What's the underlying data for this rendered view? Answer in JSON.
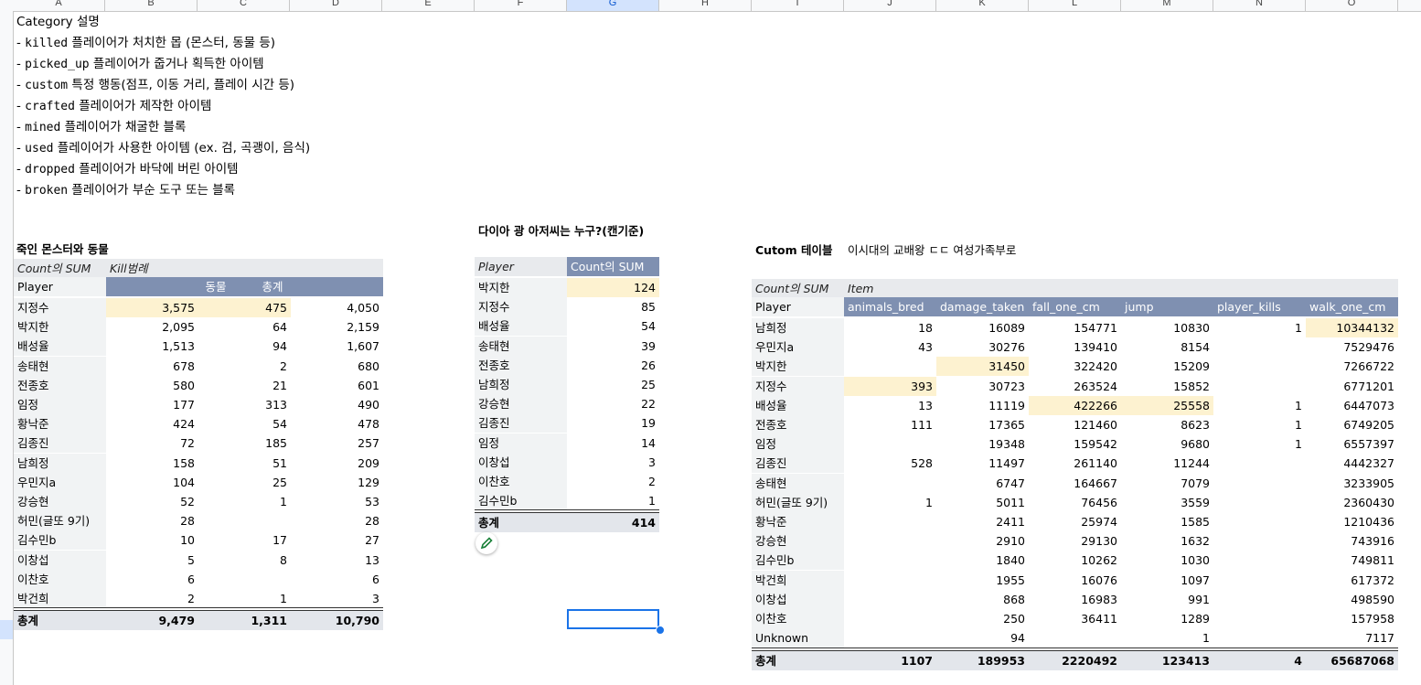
{
  "columns": [
    "A",
    "B",
    "C",
    "D",
    "E",
    "F",
    "G",
    "H",
    "I",
    "J",
    "K",
    "L",
    "M",
    "N",
    "O"
  ],
  "selected_column": "G",
  "notes": [
    {
      "text": "Category 설명",
      "code": ""
    },
    {
      "text": "- ",
      "code": "killed",
      "rest": " 플레이어가 처치한 몹 (몬스터, 동물 등)"
    },
    {
      "text": "- ",
      "code": "picked_up",
      "rest": " 플레이어가 줍거나 획득한 아이템"
    },
    {
      "text": "- ",
      "code": "custom",
      "rest": " 특정 행동(점프, 이동 거리, 플레이 시간 등)"
    },
    {
      "text": "- ",
      "code": "crafted",
      "rest": " 플레이어가 제작한 아이템"
    },
    {
      "text": "- ",
      "code": "mined",
      "rest": " 플레이어가 채굴한 블록"
    },
    {
      "text": "- ",
      "code": "used",
      "rest": " 플레이어가 사용한 아이템 (ex. 검, 곡괭이, 음식)"
    },
    {
      "text": "- ",
      "code": "dropped",
      "rest": " 플레이어가 바닥에 버린 아이템"
    },
    {
      "text": "- ",
      "code": "broken",
      "rest": " 플레이어가 부순 도구 또는 블록"
    }
  ],
  "kills": {
    "title": "죽인 몬스터와 동물",
    "meta_label": "Count의 SUM",
    "meta_value": "Kill범례",
    "header_player": "Player",
    "col1": "동물",
    "col2": "총계",
    "rows": [
      {
        "player": "지정수",
        "a": "3,575",
        "b": "475",
        "t": "4,050",
        "hl": [
          0,
          1
        ]
      },
      {
        "player": "박지한",
        "a": "2,095",
        "b": "64",
        "t": "2,159"
      },
      {
        "player": "배성율",
        "a": "1,513",
        "b": "94",
        "t": "1,607"
      },
      {
        "player": "송태현",
        "a": "678",
        "b": "2",
        "t": "680"
      },
      {
        "player": "전종호",
        "a": "580",
        "b": "21",
        "t": "601"
      },
      {
        "player": "임정",
        "a": "177",
        "b": "313",
        "t": "490"
      },
      {
        "player": "황낙준",
        "a": "424",
        "b": "54",
        "t": "478"
      },
      {
        "player": "김종진",
        "a": "72",
        "b": "185",
        "t": "257"
      },
      {
        "player": "남희정",
        "a": "158",
        "b": "51",
        "t": "209"
      },
      {
        "player": "우민지a",
        "a": "104",
        "b": "25",
        "t": "129"
      },
      {
        "player": "강승현",
        "a": "52",
        "b": "1",
        "t": "53"
      },
      {
        "player": "허민(글또 9기)",
        "a": "28",
        "b": "",
        "t": "28"
      },
      {
        "player": "김수민b",
        "a": "10",
        "b": "17",
        "t": "27"
      },
      {
        "player": "이창섭",
        "a": "5",
        "b": "8",
        "t": "13"
      },
      {
        "player": "이찬호",
        "a": "6",
        "b": "",
        "t": "6"
      },
      {
        "player": "박건희",
        "a": "2",
        "b": "1",
        "t": "3"
      }
    ],
    "total_label": "총계",
    "total": {
      "a": "9,479",
      "b": "1,311",
      "t": "10,790"
    }
  },
  "diamond": {
    "title": "다이아 광 아저씨는 누구?(캔기준)",
    "header_player": "Player",
    "header_value": "Count의 SUM",
    "rows": [
      {
        "player": "박지한",
        "v": "124",
        "hl": true
      },
      {
        "player": "지정수",
        "v": "85"
      },
      {
        "player": "배성율",
        "v": "54"
      },
      {
        "player": "송태현",
        "v": "39"
      },
      {
        "player": "전종호",
        "v": "26"
      },
      {
        "player": "남희정",
        "v": "25"
      },
      {
        "player": "강승현",
        "v": "22"
      },
      {
        "player": "김종진",
        "v": "19"
      },
      {
        "player": "임정",
        "v": "14"
      },
      {
        "player": "이창섭",
        "v": "3"
      },
      {
        "player": "이찬호",
        "v": "2"
      },
      {
        "player": "김수민b",
        "v": "1"
      }
    ],
    "total_label": "총계",
    "total": "414",
    "edit_icon": "pencil-icon"
  },
  "custom": {
    "title": "Cutom 테이블",
    "subtitle": "이시대의 교배왕 ㄷㄷ 여성가족부로",
    "meta_label": "Count의 SUM",
    "meta_value": "Item",
    "header_player": "Player",
    "headers": [
      "animals_bred",
      "damage_taken",
      "fall_one_cm",
      "jump",
      "player_kills",
      "walk_one_cm"
    ],
    "rows": [
      {
        "player": "남희정",
        "v": [
          "18",
          "16089",
          "154771",
          "10830",
          "1",
          "10344132"
        ],
        "hl": [
          5
        ]
      },
      {
        "player": "우민지a",
        "v": [
          "43",
          "30276",
          "139410",
          "8154",
          "",
          "7529476"
        ]
      },
      {
        "player": "박지한",
        "v": [
          "",
          "31450",
          "322420",
          "15209",
          "",
          "7266722"
        ],
        "hl": [
          1
        ]
      },
      {
        "player": "지정수",
        "v": [
          "393",
          "30723",
          "263524",
          "15852",
          "",
          "6771201"
        ],
        "hl": [
          0
        ]
      },
      {
        "player": "배성율",
        "v": [
          "13",
          "11119",
          "422266",
          "25558",
          "1",
          "6447073"
        ],
        "hl": [
          2,
          3
        ]
      },
      {
        "player": "전종호",
        "v": [
          "111",
          "17365",
          "121460",
          "8623",
          "1",
          "6749205"
        ]
      },
      {
        "player": "임정",
        "v": [
          "",
          "19348",
          "159542",
          "9680",
          "1",
          "6557397"
        ]
      },
      {
        "player": "김종진",
        "v": [
          "528",
          "11497",
          "261140",
          "11244",
          "",
          "4442327"
        ]
      },
      {
        "player": "송태현",
        "v": [
          "",
          "6747",
          "164667",
          "7079",
          "",
          "3233905"
        ]
      },
      {
        "player": "허민(글또 9기)",
        "v": [
          "1",
          "5011",
          "76456",
          "3559",
          "",
          "2360430"
        ]
      },
      {
        "player": "황낙준",
        "v": [
          "",
          "2411",
          "25974",
          "1585",
          "",
          "1210436"
        ]
      },
      {
        "player": "강승현",
        "v": [
          "",
          "2910",
          "29130",
          "1632",
          "",
          "743916"
        ]
      },
      {
        "player": "김수민b",
        "v": [
          "",
          "1840",
          "10262",
          "1030",
          "",
          "749811"
        ]
      },
      {
        "player": "박건희",
        "v": [
          "",
          "1955",
          "16076",
          "1097",
          "",
          "617372"
        ]
      },
      {
        "player": "이창섭",
        "v": [
          "",
          "868",
          "16983",
          "991",
          "",
          "498590"
        ]
      },
      {
        "player": "이찬호",
        "v": [
          "",
          "250",
          "36411",
          "1289",
          "",
          "157958"
        ]
      },
      {
        "player": "Unknown",
        "v": [
          "",
          "94",
          "",
          "1",
          "",
          "7117"
        ]
      }
    ],
    "total_label": "총계",
    "total": [
      "1107",
      "189953",
      "2220492",
      "123413",
      "4",
      "65687068"
    ]
  }
}
